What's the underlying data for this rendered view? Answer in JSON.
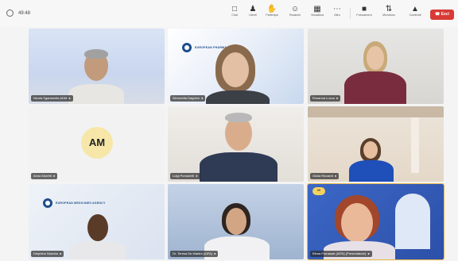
{
  "window": {
    "timer": "49:48"
  },
  "toolbar": {
    "items": [
      {
        "icon": "chat-icon",
        "label": "Chat"
      },
      {
        "icon": "people-icon",
        "label": "Utenti"
      },
      {
        "icon": "raise-hand-icon",
        "label": "Partecipa"
      },
      {
        "icon": "reactions-icon",
        "label": "Reazioni"
      },
      {
        "icon": "view-icon",
        "label": "Visualizza"
      },
      {
        "icon": "more-icon",
        "label": "Altro"
      },
      {
        "icon": "camera-icon",
        "label": "Fotocamera"
      },
      {
        "icon": "mic-icon",
        "label": "Microfono"
      },
      {
        "icon": "share-icon",
        "label": "Condividi"
      }
    ],
    "leave_label": "Esci"
  },
  "participants": [
    {
      "name": "Nicola Sgaramella ADM",
      "video": true
    },
    {
      "name": "Simonetta Dagnino",
      "video": true,
      "logo": "EUROPEAN PHARMA AGENCY"
    },
    {
      "name": "Rosanna Lucca",
      "video": true
    },
    {
      "name": "Anna Moretti",
      "video": false,
      "initials": "AM"
    },
    {
      "name": "Luigi Pomanelli",
      "video": true
    },
    {
      "name": "Giulia Riccardi",
      "video": true
    },
    {
      "name": "Delphine Ntumba",
      "video": true,
      "logo": "EUROPEAN MEDICINES AGENCY"
    },
    {
      "name": "Dr. Teresa De Martini (AIFA)",
      "video": true
    },
    {
      "name": "Elena Fornasari (AIFA) (Presentatore)",
      "video": true,
      "active": true
    }
  ],
  "colors": {
    "leave": "#d93a35",
    "active_border": "#e8b84a",
    "avatar_bg": "#f6e7a8"
  }
}
